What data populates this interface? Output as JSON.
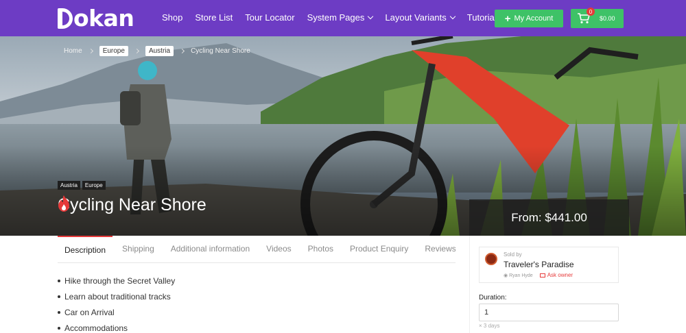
{
  "header": {
    "logo_text": "okan",
    "nav": [
      {
        "label": "Shop",
        "has_dropdown": false
      },
      {
        "label": "Store List",
        "has_dropdown": false
      },
      {
        "label": "Tour Locator",
        "has_dropdown": false
      },
      {
        "label": "System Pages",
        "has_dropdown": true
      },
      {
        "label": "Layout Variants",
        "has_dropdown": true
      },
      {
        "label": "Tutorials",
        "has_dropdown": false
      }
    ],
    "account_label": "My Account",
    "cart_count": "0",
    "cart_total": "$0.00"
  },
  "breadcrumb": {
    "home": "Home",
    "items": [
      "Europe",
      "Austria"
    ],
    "current": "Cycling Near Shore"
  },
  "hero": {
    "tags": [
      "Austria",
      "Europe"
    ],
    "title": "Cycling Near Shore",
    "price": "From: $441.00"
  },
  "tabs": [
    "Description",
    "Shipping",
    "Additional information",
    "Videos",
    "Photos",
    "Product Enquiry",
    "Reviews"
  ],
  "description_items": [
    "Hike through the Secret Valley",
    "Learn about traditional tracks",
    "Car on Arrival",
    "Accommodations"
  ],
  "vendor": {
    "sold_by": "Sold by",
    "name": "Traveler's Paradise",
    "owner": "Ryan Hyde",
    "ask_owner": "Ask owner"
  },
  "booking": {
    "duration_label": "Duration:",
    "duration_value": "1",
    "duration_hint": "× 3 days"
  },
  "colors": {
    "header_bg": "#6d3cc4",
    "button_green": "#3ec267",
    "accent_red": "#e63939"
  }
}
